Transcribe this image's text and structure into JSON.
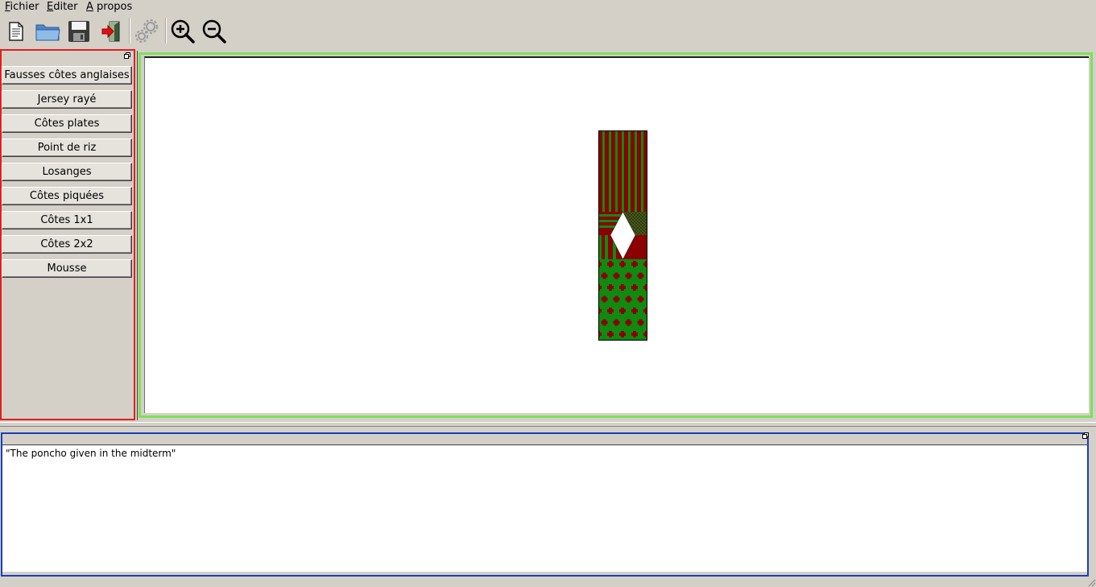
{
  "menubar": {
    "items": [
      {
        "mnemonic": "F",
        "rest": "ichier"
      },
      {
        "mnemonic": "E",
        "rest": "diter"
      },
      {
        "mnemonic": "A",
        "rest": " propos"
      }
    ]
  },
  "toolbar": {
    "buttons": [
      "new-document-icon",
      "open-folder-icon",
      "save-icon",
      "exit-icon",
      "settings-gears-icon",
      "zoom-in-icon",
      "zoom-out-icon"
    ]
  },
  "stitches": {
    "items": [
      "Fausses côtes anglaises",
      "Jersey rayé",
      "Côtes plates",
      "Point de riz",
      "Losanges",
      "Côtes piquées",
      "Côtes 1x1",
      "Côtes 2x2",
      "Mousse"
    ]
  },
  "description": {
    "text": "\"The poncho given in the midterm\""
  },
  "colors": {
    "dark_red": "#8b0000",
    "green": "#108a10",
    "left_dock_border": "#e21e1e",
    "canvas_border": "#7ee05a",
    "bottom_dock_border": "#1a3fb8"
  }
}
